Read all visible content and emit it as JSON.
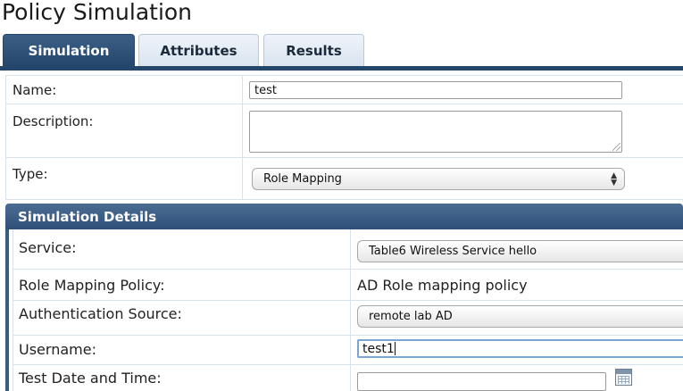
{
  "page": {
    "title": "Policy Simulation"
  },
  "tabs": [
    {
      "label": "Simulation",
      "active": true
    },
    {
      "label": "Attributes",
      "active": false
    },
    {
      "label": "Results",
      "active": false
    }
  ],
  "form": {
    "name_label": "Name:",
    "name_value": "test",
    "description_label": "Description:",
    "description_value": "",
    "type_label": "Type:",
    "type_value": "Role Mapping"
  },
  "details": {
    "header": "Simulation Details",
    "service_label": "Service:",
    "service_value": "Table6 Wireless Service hello",
    "policy_label": "Role Mapping Policy:",
    "policy_value": "AD Role mapping policy",
    "auth_label": "Authentication Source:",
    "auth_value": "remote lab AD",
    "username_label": "Username:",
    "username_value": "test1",
    "datetime_label": "Test Date and Time:",
    "datetime_value": ""
  },
  "icons": {
    "calendar": "calendar-icon",
    "select_arrows": "select-arrows-icon"
  },
  "colors": {
    "tab_active": "#25466b",
    "section_header": "#3a5b82",
    "grid_line": "#d7e2ee"
  }
}
